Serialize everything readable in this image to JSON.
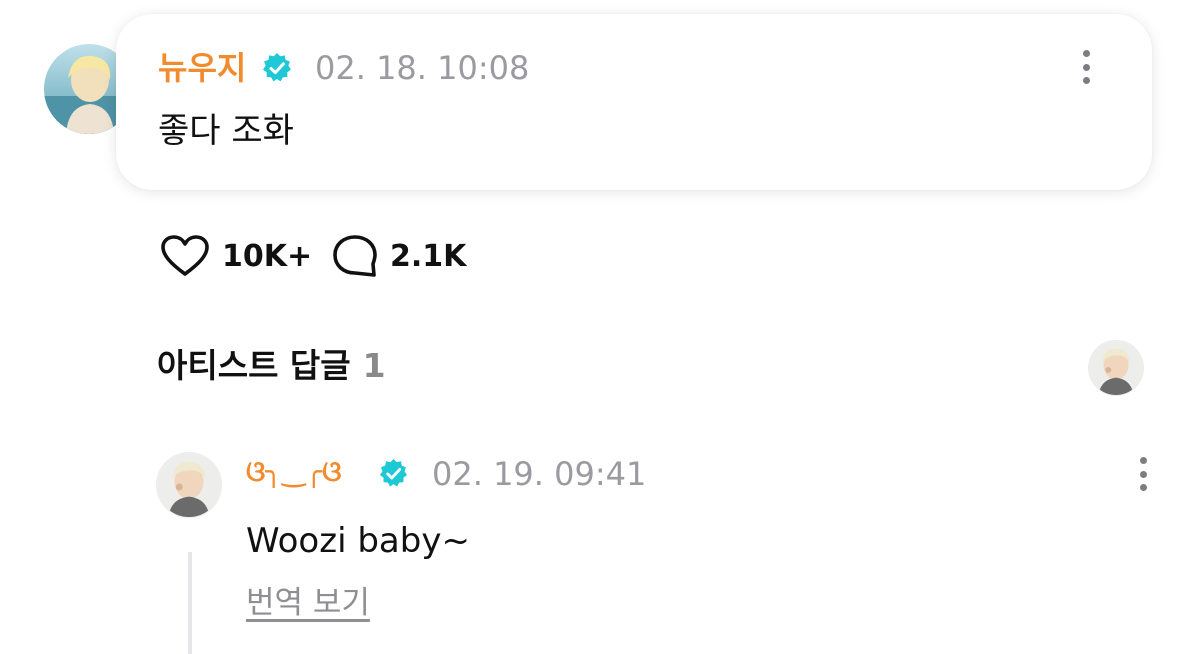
{
  "post": {
    "author": "뉴우지",
    "timestamp": "02. 18. 10:08",
    "text": "좋다 조화",
    "author_color": "#f28a2e",
    "verified_color": "#1ec8d4"
  },
  "actions": {
    "like_count": "10K+",
    "comment_count": "2.1K"
  },
  "artist_replies": {
    "title": "아티스트 답글",
    "count": "1"
  },
  "reply": {
    "author": "ଓ╮‿╭ଓ",
    "timestamp": "02. 19. 09:41",
    "text": "Woozi baby~",
    "translate_label": "번역 보기"
  },
  "icons": {
    "verified": "verified-badge-icon",
    "more": "more-vertical-icon",
    "like": "heart-icon",
    "comment": "comment-bubble-icon"
  }
}
